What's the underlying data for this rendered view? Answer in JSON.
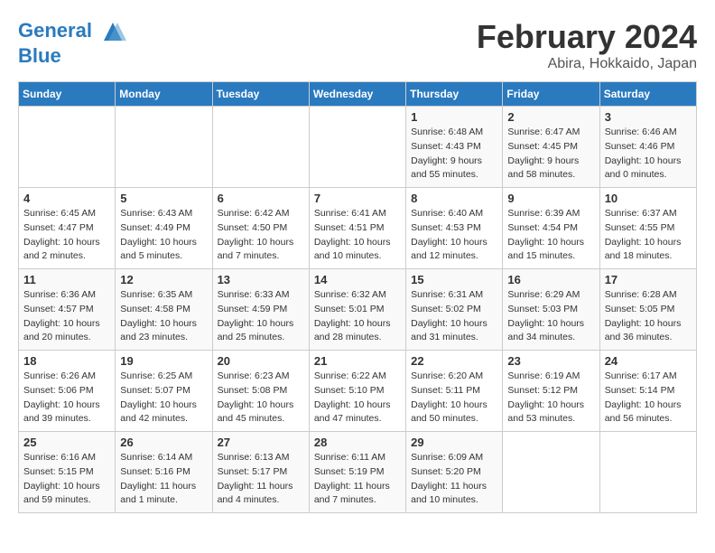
{
  "header": {
    "logo_line1": "General",
    "logo_line2": "Blue",
    "month": "February 2024",
    "location": "Abira, Hokkaido, Japan"
  },
  "weekdays": [
    "Sunday",
    "Monday",
    "Tuesday",
    "Wednesday",
    "Thursday",
    "Friday",
    "Saturday"
  ],
  "weeks": [
    [
      {
        "day": "",
        "sunrise": "",
        "sunset": "",
        "daylight": ""
      },
      {
        "day": "",
        "sunrise": "",
        "sunset": "",
        "daylight": ""
      },
      {
        "day": "",
        "sunrise": "",
        "sunset": "",
        "daylight": ""
      },
      {
        "day": "",
        "sunrise": "",
        "sunset": "",
        "daylight": ""
      },
      {
        "day": "1",
        "sunrise": "Sunrise: 6:48 AM",
        "sunset": "Sunset: 4:43 PM",
        "daylight": "Daylight: 9 hours and 55 minutes."
      },
      {
        "day": "2",
        "sunrise": "Sunrise: 6:47 AM",
        "sunset": "Sunset: 4:45 PM",
        "daylight": "Daylight: 9 hours and 58 minutes."
      },
      {
        "day": "3",
        "sunrise": "Sunrise: 6:46 AM",
        "sunset": "Sunset: 4:46 PM",
        "daylight": "Daylight: 10 hours and 0 minutes."
      }
    ],
    [
      {
        "day": "4",
        "sunrise": "Sunrise: 6:45 AM",
        "sunset": "Sunset: 4:47 PM",
        "daylight": "Daylight: 10 hours and 2 minutes."
      },
      {
        "day": "5",
        "sunrise": "Sunrise: 6:43 AM",
        "sunset": "Sunset: 4:49 PM",
        "daylight": "Daylight: 10 hours and 5 minutes."
      },
      {
        "day": "6",
        "sunrise": "Sunrise: 6:42 AM",
        "sunset": "Sunset: 4:50 PM",
        "daylight": "Daylight: 10 hours and 7 minutes."
      },
      {
        "day": "7",
        "sunrise": "Sunrise: 6:41 AM",
        "sunset": "Sunset: 4:51 PM",
        "daylight": "Daylight: 10 hours and 10 minutes."
      },
      {
        "day": "8",
        "sunrise": "Sunrise: 6:40 AM",
        "sunset": "Sunset: 4:53 PM",
        "daylight": "Daylight: 10 hours and 12 minutes."
      },
      {
        "day": "9",
        "sunrise": "Sunrise: 6:39 AM",
        "sunset": "Sunset: 4:54 PM",
        "daylight": "Daylight: 10 hours and 15 minutes."
      },
      {
        "day": "10",
        "sunrise": "Sunrise: 6:37 AM",
        "sunset": "Sunset: 4:55 PM",
        "daylight": "Daylight: 10 hours and 18 minutes."
      }
    ],
    [
      {
        "day": "11",
        "sunrise": "Sunrise: 6:36 AM",
        "sunset": "Sunset: 4:57 PM",
        "daylight": "Daylight: 10 hours and 20 minutes."
      },
      {
        "day": "12",
        "sunrise": "Sunrise: 6:35 AM",
        "sunset": "Sunset: 4:58 PM",
        "daylight": "Daylight: 10 hours and 23 minutes."
      },
      {
        "day": "13",
        "sunrise": "Sunrise: 6:33 AM",
        "sunset": "Sunset: 4:59 PM",
        "daylight": "Daylight: 10 hours and 25 minutes."
      },
      {
        "day": "14",
        "sunrise": "Sunrise: 6:32 AM",
        "sunset": "Sunset: 5:01 PM",
        "daylight": "Daylight: 10 hours and 28 minutes."
      },
      {
        "day": "15",
        "sunrise": "Sunrise: 6:31 AM",
        "sunset": "Sunset: 5:02 PM",
        "daylight": "Daylight: 10 hours and 31 minutes."
      },
      {
        "day": "16",
        "sunrise": "Sunrise: 6:29 AM",
        "sunset": "Sunset: 5:03 PM",
        "daylight": "Daylight: 10 hours and 34 minutes."
      },
      {
        "day": "17",
        "sunrise": "Sunrise: 6:28 AM",
        "sunset": "Sunset: 5:05 PM",
        "daylight": "Daylight: 10 hours and 36 minutes."
      }
    ],
    [
      {
        "day": "18",
        "sunrise": "Sunrise: 6:26 AM",
        "sunset": "Sunset: 5:06 PM",
        "daylight": "Daylight: 10 hours and 39 minutes."
      },
      {
        "day": "19",
        "sunrise": "Sunrise: 6:25 AM",
        "sunset": "Sunset: 5:07 PM",
        "daylight": "Daylight: 10 hours and 42 minutes."
      },
      {
        "day": "20",
        "sunrise": "Sunrise: 6:23 AM",
        "sunset": "Sunset: 5:08 PM",
        "daylight": "Daylight: 10 hours and 45 minutes."
      },
      {
        "day": "21",
        "sunrise": "Sunrise: 6:22 AM",
        "sunset": "Sunset: 5:10 PM",
        "daylight": "Daylight: 10 hours and 47 minutes."
      },
      {
        "day": "22",
        "sunrise": "Sunrise: 6:20 AM",
        "sunset": "Sunset: 5:11 PM",
        "daylight": "Daylight: 10 hours and 50 minutes."
      },
      {
        "day": "23",
        "sunrise": "Sunrise: 6:19 AM",
        "sunset": "Sunset: 5:12 PM",
        "daylight": "Daylight: 10 hours and 53 minutes."
      },
      {
        "day": "24",
        "sunrise": "Sunrise: 6:17 AM",
        "sunset": "Sunset: 5:14 PM",
        "daylight": "Daylight: 10 hours and 56 minutes."
      }
    ],
    [
      {
        "day": "25",
        "sunrise": "Sunrise: 6:16 AM",
        "sunset": "Sunset: 5:15 PM",
        "daylight": "Daylight: 10 hours and 59 minutes."
      },
      {
        "day": "26",
        "sunrise": "Sunrise: 6:14 AM",
        "sunset": "Sunset: 5:16 PM",
        "daylight": "Daylight: 11 hours and 1 minute."
      },
      {
        "day": "27",
        "sunrise": "Sunrise: 6:13 AM",
        "sunset": "Sunset: 5:17 PM",
        "daylight": "Daylight: 11 hours and 4 minutes."
      },
      {
        "day": "28",
        "sunrise": "Sunrise: 6:11 AM",
        "sunset": "Sunset: 5:19 PM",
        "daylight": "Daylight: 11 hours and 7 minutes."
      },
      {
        "day": "29",
        "sunrise": "Sunrise: 6:09 AM",
        "sunset": "Sunset: 5:20 PM",
        "daylight": "Daylight: 11 hours and 10 minutes."
      },
      {
        "day": "",
        "sunrise": "",
        "sunset": "",
        "daylight": ""
      },
      {
        "day": "",
        "sunrise": "",
        "sunset": "",
        "daylight": ""
      }
    ]
  ]
}
